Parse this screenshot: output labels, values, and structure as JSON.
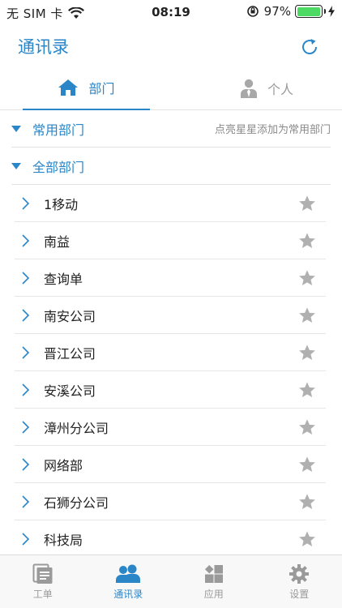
{
  "status": {
    "carrier": "无 SIM 卡",
    "time": "08:19",
    "battery_pct": "97%",
    "battery_level": 0.97
  },
  "nav": {
    "title": "通讯录",
    "refresh_icon": "refresh-icon"
  },
  "tabs": [
    {
      "label": "部门",
      "icon": "home-icon",
      "active": true
    },
    {
      "label": "个人",
      "icon": "person-icon",
      "active": false
    }
  ],
  "sections": {
    "common": {
      "title": "常用部门",
      "hint": "点亮星星添加为常用部门"
    },
    "all": {
      "title": "全部部门"
    }
  },
  "departments": [
    {
      "name": "1移动"
    },
    {
      "name": "南益"
    },
    {
      "name": "查询单"
    },
    {
      "name": "南安公司"
    },
    {
      "name": "晋江公司"
    },
    {
      "name": "安溪公司"
    },
    {
      "name": "漳州分公司"
    },
    {
      "name": "网络部"
    },
    {
      "name": "石狮分公司"
    },
    {
      "name": "科技局"
    }
  ],
  "tabbar": [
    {
      "label": "工单",
      "icon": "workorder-icon",
      "active": false
    },
    {
      "label": "通讯录",
      "icon": "contacts-icon",
      "active": true
    },
    {
      "label": "应用",
      "icon": "apps-icon",
      "active": false
    },
    {
      "label": "设置",
      "icon": "gear-icon",
      "active": false
    }
  ],
  "colors": {
    "accent": "#2b86c8",
    "star": "#b0b0b0",
    "battery": "#4cd964"
  }
}
